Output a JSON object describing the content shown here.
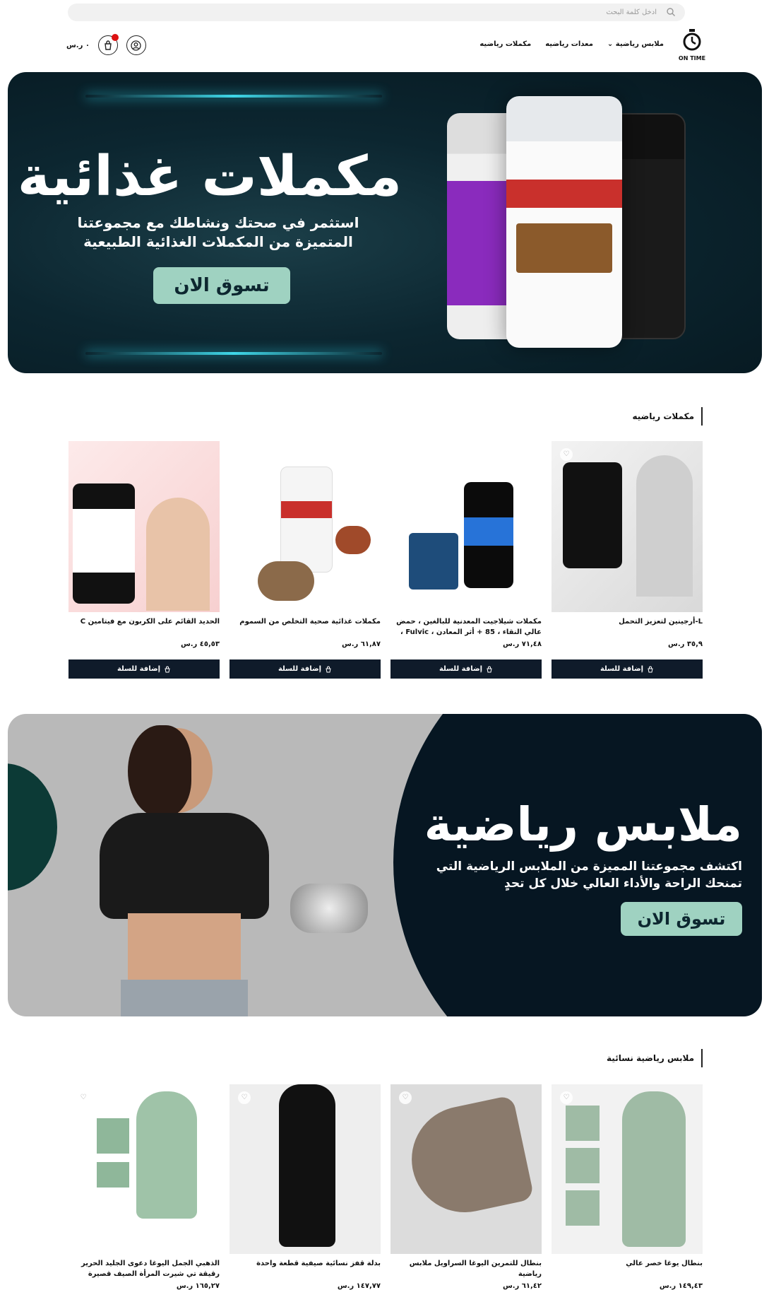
{
  "search": {
    "placeholder": "ادخل كلمة البحث"
  },
  "logo": {
    "text": "ON TIME"
  },
  "nav": {
    "items": [
      "ملابس رياضية",
      "معدات رياضيه",
      "مكملات رياضيه"
    ]
  },
  "header": {
    "cart_total": "٠ ر.س"
  },
  "hero1": {
    "title": "مكملات غذائية",
    "subtitle": "استثمر في صحتك ونشاطك مع مجموعتنا المتميزة من المكملات الغذائية الطبيعية",
    "cta": "تسوق الان"
  },
  "section1": {
    "title": "مكملات رياضيه",
    "add_label": "إضافة للسلة",
    "products": [
      {
        "name": "L-أرجينين لتعزيز التحمل",
        "price": "٣٥,٩ ر.س"
      },
      {
        "name": "مكملات شيلاجيت المعدنية للبالغين ، حمض عالي النقاء ، 85 + أثر المعادن ، Fulvic ، جسم أيض عضوي طبيعي ، صحي",
        "price": "٧١,٤٨ ر.س"
      },
      {
        "name": "مكملات غذائية صحية التخلص من السموم",
        "price": "٦١,٨٧ ر.س"
      },
      {
        "name": "الحديد القائم على الكربون مع فيتامين C",
        "price": "٤٥,٥٣ ر.س"
      }
    ]
  },
  "hero2": {
    "title": "ملابس رياضية",
    "subtitle": "اكتشف مجموعتنا المميزة من الملابس الرياضية التي تمنحك الراحة والأداء العالي خلال كل تحدٍ",
    "cta": "تسوق الان"
  },
  "section2": {
    "title": "ملابس رياضية نسائية",
    "products": [
      {
        "name": "بنطال يوغا خصر عالي",
        "price": "١٤٩,٤٣ ر.س"
      },
      {
        "name": "بنطال للتمرين اليوغا السراويل ملابس رياضية",
        "price": "٦١,٤٢ ر.س"
      },
      {
        "name": "بدلة قفز نسائية صيفية قطعة واحدة",
        "price": "١٤٧,٧٧ ر.س"
      },
      {
        "name": "الذهبي الجمل اليوغا دعوى الجليد الحرير رقيقة تي شيرت المرأة الصيف قصيرة الأكمام عادية تشغيل السراويل الرياضية الصالة الرياضية اللياقة البدنية الملابس",
        "price": "١٦٥,٢٧ ر.س"
      }
    ]
  },
  "colors": {
    "dark": "#0f1b2a",
    "accent": "#9fd2c1",
    "hero_bg": "#0c2630"
  }
}
